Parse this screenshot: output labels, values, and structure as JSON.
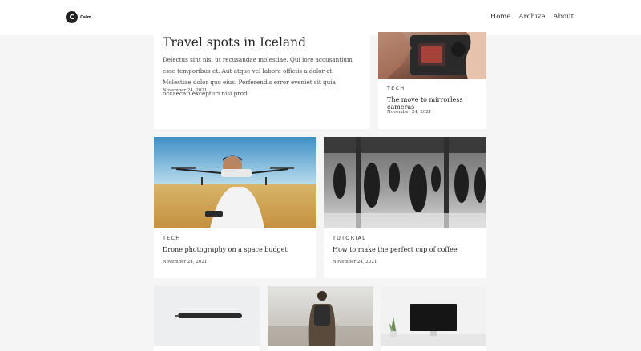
{
  "brand": {
    "logo_letter": "C",
    "name": "Calm"
  },
  "nav": {
    "items": [
      "Home",
      "Archive",
      "About"
    ]
  },
  "featured": {
    "title": "Travel spots in Iceland",
    "excerpt": "Delectus sint nisi ut recusandae molestiae. Qui iore accusantium esse temporibus et. Aut atque vel labore officiis a dolor et. Molestiae dolor quo eius. Perferendis error eveniet sit quia occaecati excepturi nisi prod.",
    "date": "November 24, 2021"
  },
  "posts": [
    {
      "category": "TECH",
      "title": "The move to mirrorless cameras",
      "date": "November 24, 2021",
      "image": "camera-photo"
    },
    {
      "category": "TECH",
      "title": "Drone photography on a space budget",
      "date": "November 24, 2021",
      "image": "drone-photo"
    },
    {
      "category": "TUTORIAL",
      "title": "How to make the perfect cup of coffee",
      "date": "November 24, 2021",
      "image": "crowd-photo"
    }
  ],
  "bottom_images": [
    "pen-photo",
    "hiker-photo",
    "desk-photo"
  ],
  "colors": {
    "page_bg": "#f5f5f5",
    "card_bg": "#ffffff",
    "text": "#222222"
  }
}
